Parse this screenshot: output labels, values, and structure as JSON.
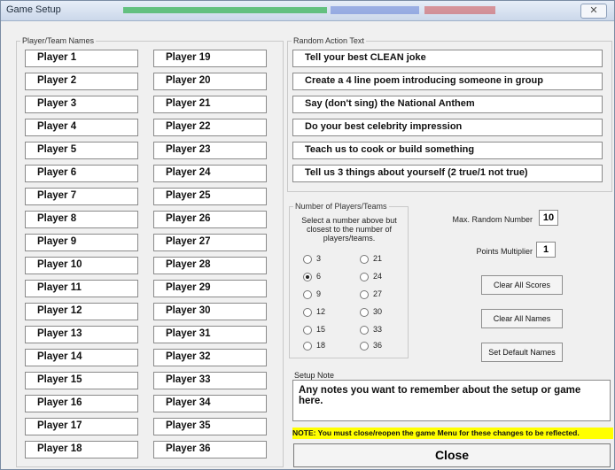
{
  "window": {
    "title": "Game Setup",
    "close_glyph": "✕"
  },
  "players": {
    "legend": "Player/Team Names",
    "col1": [
      "Player 1",
      "Player 2",
      "Player 3",
      "Player 4",
      "Player 5",
      "Player 6",
      "Player 7",
      "Player 8",
      "Player 9",
      "Player 10",
      "Player 11",
      "Player 12",
      "Player 13",
      "Player 14",
      "Player 15",
      "Player 16",
      "Player 17",
      "Player 18"
    ],
    "col2": [
      "Player 19",
      "Player 20",
      "Player 21",
      "Player 22",
      "Player 23",
      "Player 24",
      "Player 25",
      "Player 26",
      "Player 27",
      "Player 28",
      "Player 29",
      "Player 30",
      "Player 31",
      "Player 32",
      "Player 33",
      "Player 34",
      "Player 35",
      "Player 36"
    ]
  },
  "actions": {
    "legend": "Random Action Text",
    "items": [
      "Tell your best CLEAN joke",
      "Create a 4 line poem introducing someone in group",
      "Say (don't sing) the National Anthem",
      "Do your best celebrity impression",
      "Teach us to cook or build something",
      "Tell us 3 things about yourself (2 true/1 not true)"
    ]
  },
  "teams": {
    "legend": "Number of Players/Teams",
    "instructions": "Select a number above but closest to the number of players/teams.",
    "options_left": [
      "3",
      "6",
      "9",
      "12",
      "15",
      "18"
    ],
    "options_right": [
      "21",
      "24",
      "27",
      "30",
      "33",
      "36"
    ],
    "selected": "6"
  },
  "settings": {
    "max_random_label": "Max. Random Number",
    "max_random_value": "10",
    "points_multiplier_label": "Points Multiplier",
    "points_multiplier_value": "1"
  },
  "buttons": {
    "clear_scores": "Clear All Scores",
    "clear_names": "Clear All Names",
    "default_names": "Set Default Names",
    "close": "Close"
  },
  "setup_note": {
    "label": "Setup Note",
    "text": "Any notes you want to remember about the setup or game here."
  },
  "warning": "NOTE: You must close/reopen the game Menu for these changes to be reflected.",
  "colors": {
    "warning_bg": "#ffff00",
    "window_bg": "#f0f0f0"
  }
}
